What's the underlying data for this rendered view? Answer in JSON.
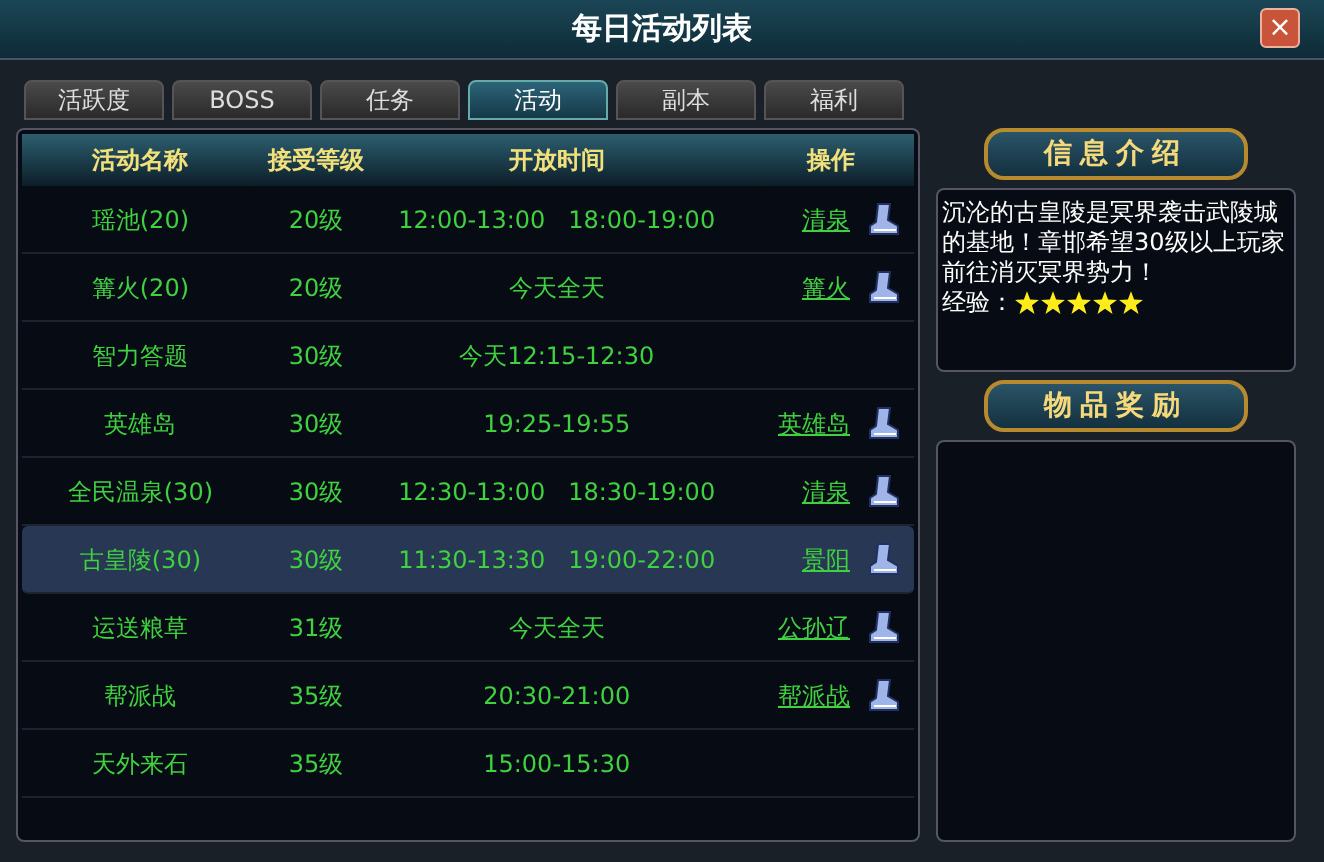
{
  "window": {
    "title": "每日活动列表",
    "close": "×"
  },
  "tabs": [
    {
      "label": "活跃度",
      "selected": false
    },
    {
      "label": "BOSS",
      "selected": false
    },
    {
      "label": "任务",
      "selected": false
    },
    {
      "label": "活动",
      "selected": true
    },
    {
      "label": "副本",
      "selected": false
    },
    {
      "label": "福利",
      "selected": false
    }
  ],
  "table": {
    "columns": [
      "活动名称",
      "接受等级",
      "开放时间",
      "操作"
    ],
    "rows": [
      {
        "name": "瑶池(20)",
        "level": "20级",
        "time": "12:00-13:00   18:00-19:00",
        "action": "清泉",
        "selected": false
      },
      {
        "name": "篝火(20)",
        "level": "20级",
        "time": "今天全天",
        "action": "篝火",
        "selected": false
      },
      {
        "name": "智力答题",
        "level": "30级",
        "time": "今天12:15-12:30",
        "selected": false
      },
      {
        "name": "英雄岛",
        "level": "30级",
        "time": "19:25-19:55",
        "action": "英雄岛",
        "selected": false
      },
      {
        "name": "全民温泉(30)",
        "level": "30级",
        "time": "12:30-13:00   18:30-19:00",
        "action": "清泉",
        "selected": false
      },
      {
        "name": "古皇陵(30)",
        "level": "30级",
        "time": "11:30-13:30   19:00-22:00",
        "action": "景阳",
        "selected": true
      },
      {
        "name": "运送粮草",
        "level": "31级",
        "time": "今天全天",
        "action": "公孙辽",
        "selected": false
      },
      {
        "name": "帮派战",
        "level": "35级",
        "time": "20:30-21:00",
        "action": "帮派战",
        "selected": false
      },
      {
        "name": "天外来石",
        "level": "35级",
        "time": "15:00-15:30",
        "selected": false
      }
    ]
  },
  "info": {
    "title": "信息介绍",
    "description": "沉沦的古皇陵是冥界袭击武陵城的基地！章邯希望30级以上玩家前往消灭冥界势力！",
    "exp_label": "经验：",
    "stars": 5
  },
  "rewards": {
    "title": "物品奖励"
  }
}
